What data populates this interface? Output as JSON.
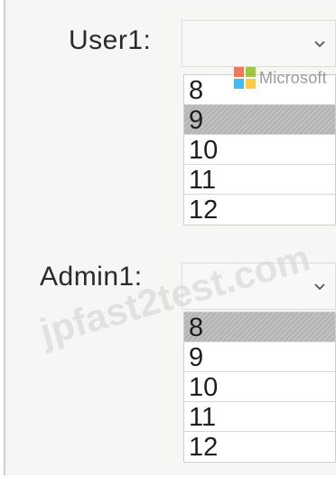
{
  "user1": {
    "label": "User1:",
    "dropdown_icon": "chevron-down-icon",
    "options": [
      {
        "label": "8",
        "selected": false
      },
      {
        "label": "9",
        "selected": true
      },
      {
        "label": "10",
        "selected": false
      },
      {
        "label": "11",
        "selected": false
      },
      {
        "label": "12",
        "selected": false
      }
    ]
  },
  "admin1": {
    "label": "Admin1:",
    "dropdown_icon": "chevron-down-icon",
    "options": [
      {
        "label": "8",
        "selected": true
      },
      {
        "label": "9",
        "selected": false
      },
      {
        "label": "10",
        "selected": false
      },
      {
        "label": "11",
        "selected": false
      },
      {
        "label": "12",
        "selected": false
      }
    ]
  },
  "watermark": {
    "brand_text": "Microsoft",
    "colors": [
      "#f25022",
      "#7fba00",
      "#00a4ef",
      "#ffb900"
    ],
    "overlay_text": "jpfast2test.com"
  }
}
